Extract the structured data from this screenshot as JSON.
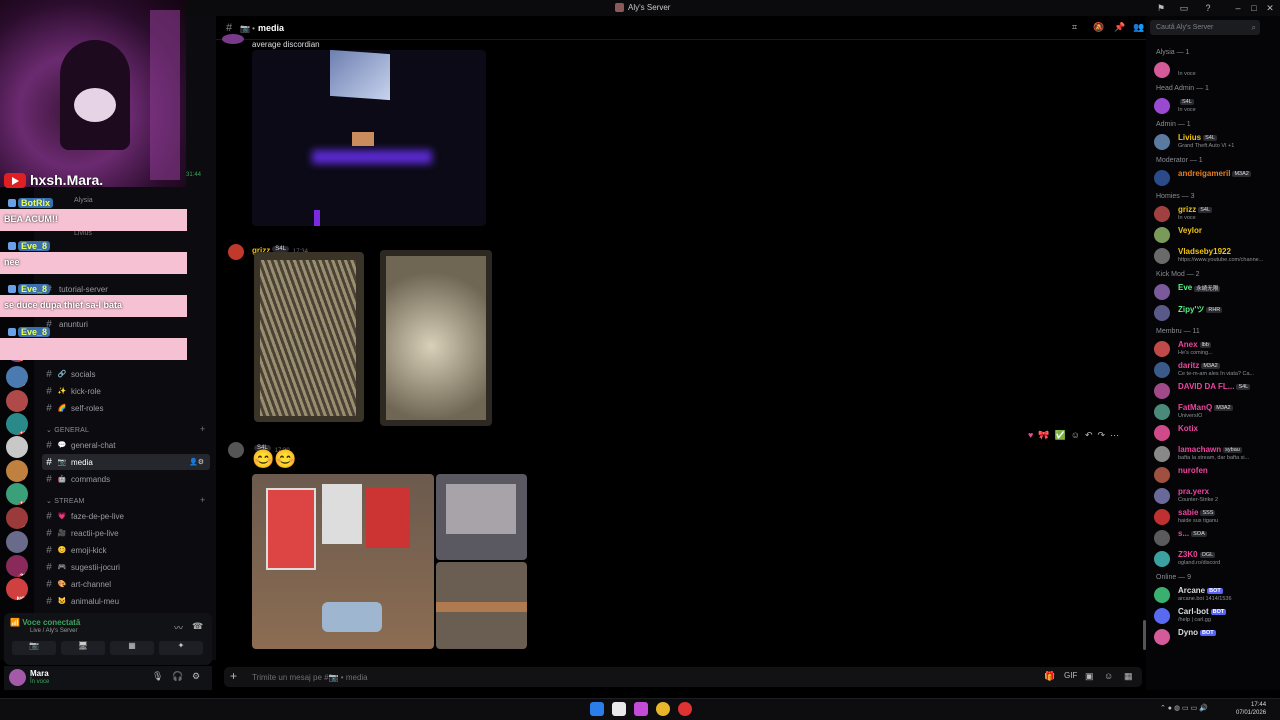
{
  "window": {
    "title": "Aly's Server"
  },
  "stream_overlay": {
    "streamer": "hxsh.Mara.",
    "chat": [
      {
        "name": "BotRix",
        "msg": "BEA ACUM!!"
      },
      {
        "name": "Eve_8",
        "msg": "nee"
      },
      {
        "name": "Eve_8",
        "msg": "se duce dupa thief sa-l bata"
      },
      {
        "name": "Eve_8",
        "msg": ""
      }
    ]
  },
  "servers": [
    {
      "badge": "336"
    },
    {
      "badge": "24"
    },
    {
      "badge": "62"
    },
    {
      "badge": "171"
    },
    {
      "badge": ""
    },
    {
      "badge": "31"
    },
    {
      "badge": "124"
    },
    {
      "badge": "32"
    },
    {
      "badge": ""
    },
    {
      "badge": "339"
    },
    {
      "badge": "NOU"
    }
  ],
  "sidebar": {
    "partial": {
      "alysia": "Alysia",
      "livius": "Livius",
      "tutorial": "tutorial-server",
      "anunturi": "anunturi",
      "side_time": "31:44",
      "side_text": "ct-uri"
    },
    "channels_top": [
      {
        "emoji": "🔗",
        "label": "socials"
      },
      {
        "emoji": "✨",
        "label": "kick-role"
      },
      {
        "emoji": "🌈",
        "label": "self-roles"
      }
    ],
    "cat_general": "GENERAL",
    "channels_general": [
      {
        "emoji": "💬",
        "label": "general-chat"
      },
      {
        "emoji": "📷",
        "label": "media",
        "active": true
      },
      {
        "emoji": "🤖",
        "label": "commands"
      }
    ],
    "cat_stream": "STREAM",
    "channels_stream": [
      {
        "emoji": "💗",
        "label": "faze-de-pe-live"
      },
      {
        "emoji": "🎥",
        "label": "reactii-pe-live"
      },
      {
        "emoji": "😊",
        "label": "emoji-kick"
      },
      {
        "emoji": "🎮",
        "label": "sugestii-jocuri"
      },
      {
        "emoji": "🎨",
        "label": "art-channel"
      },
      {
        "emoji": "🐱",
        "label": "animalul-meu"
      }
    ]
  },
  "voice": {
    "status": "Voce conectată",
    "location": "Live / Aly's Server"
  },
  "user": {
    "name": "Mara",
    "status": "În voce"
  },
  "header": {
    "channel": "media"
  },
  "messages": [
    {
      "author": "",
      "text": "average discordian"
    },
    {
      "author": "grizz",
      "tag": "S4L",
      "time": "17:34"
    },
    {
      "author": "",
      "tag": "S4L",
      "time": "17:39",
      "text": "😊😊"
    }
  ],
  "composer": {
    "placeholder": "Trimite un mesaj pe #📷 • media"
  },
  "members": {
    "search_placeholder": "Caută Aly's Server",
    "groups": [
      {
        "title": "Alysia — 1",
        "items": [
          {
            "name": "",
            "status": "În voce",
            "color": "#dbdee1"
          }
        ]
      },
      {
        "title": "Head Admin — 1",
        "items": [
          {
            "name": "",
            "role": "S4L",
            "status": "În voce",
            "color": "#e84f8a"
          }
        ]
      },
      {
        "title": "Admin — 1",
        "items": [
          {
            "name": "Livius",
            "role": "S4L",
            "status": "Grand Theft Auto VI +1",
            "color": "#f1c40f"
          }
        ]
      },
      {
        "title": "Moderator — 1",
        "items": [
          {
            "name": "andreigameril",
            "role": "M3A2",
            "status": "",
            "color": "#e67e22"
          }
        ]
      },
      {
        "title": "Homies — 3",
        "items": [
          {
            "name": "grizz",
            "role": "S4L",
            "status": "În voce",
            "color": "#f1c40f"
          },
          {
            "name": "Veylor",
            "status": "",
            "color": "#f1c40f"
          },
          {
            "name": "Vladseby1922",
            "status": "https://www.youtube.com/channe...",
            "color": "#f1c40f"
          }
        ]
      },
      {
        "title": "Kick Mod — 2",
        "items": [
          {
            "name": "Eve",
            "role": "永続无限",
            "status": "",
            "color": "#57f287"
          },
          {
            "name": "Zipy'ツ",
            "role": "RHR",
            "status": "",
            "color": "#57f287"
          }
        ]
      },
      {
        "title": "Membru — 11",
        "items": [
          {
            "name": "Anex",
            "role": "lbb",
            "status": "He's coming...",
            "color": "#eb459e"
          },
          {
            "name": "daritz",
            "role": "M3A2",
            "status": "Ce te-m-am ales în viata? Ca...",
            "color": "#eb459e"
          },
          {
            "name": "DAVID DA FL...",
            "role": "S4L",
            "status": "",
            "color": "#eb459e"
          },
          {
            "name": "FatManQ",
            "role": "M3A2",
            "status": "UniversIO",
            "color": "#eb459e"
          },
          {
            "name": "Kotix",
            "status": "",
            "color": "#eb459e"
          },
          {
            "name": "lamachawn",
            "role": "sybau",
            "status": "bafta la stream, dar bafta si...",
            "color": "#eb459e"
          },
          {
            "name": "nurofen",
            "status": "",
            "color": "#eb459e"
          },
          {
            "name": "pra.yerx",
            "status": "Counter-Strike 2",
            "color": "#eb459e"
          },
          {
            "name": "sabie",
            "role": "SSS",
            "status": "haide sus tiganu",
            "color": "#eb459e"
          },
          {
            "name": "s...",
            "role": "SOA",
            "status": "",
            "color": "#eb459e"
          },
          {
            "name": "Z3K0",
            "role": "OGL",
            "status": "ogland.ro/discord",
            "color": "#eb459e"
          }
        ]
      },
      {
        "title": "Online — 9",
        "items": [
          {
            "name": "Arcane",
            "bot": "BOT",
            "status": "arcane.bot 1414/1536",
            "color": "#dbdee1"
          },
          {
            "name": "Carl-bot",
            "bot": "BOT",
            "status": "/help | carl.gg",
            "color": "#dbdee1"
          },
          {
            "name": "Dyno",
            "bot": "BOT",
            "status": "",
            "color": "#dbdee1"
          }
        ]
      }
    ]
  },
  "taskbar": {
    "time": "17:44",
    "date": "07/01/2026"
  },
  "colors": {
    "accent": "#5865f2",
    "pink_chat": "#f6c1d3"
  }
}
